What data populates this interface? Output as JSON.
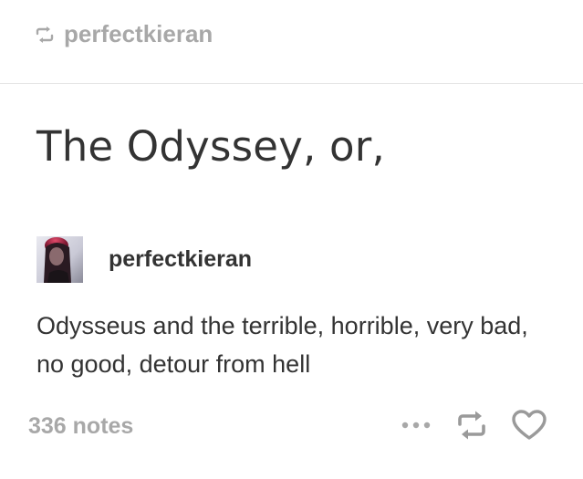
{
  "header": {
    "reblog_icon": "reblog-icon",
    "reblogged_from": "perfectkieran"
  },
  "post": {
    "title": "The Odyssey, or,",
    "author": {
      "avatar_icon": "user-avatar",
      "name": "perfectkieran"
    },
    "body": "Odysseus and the terrible, horrible, very bad, no good, detour from hell"
  },
  "footer": {
    "notes": "336 notes",
    "actions": [
      {
        "icon": "more-dots-icon"
      },
      {
        "icon": "reblog-icon"
      },
      {
        "icon": "heart-icon"
      }
    ]
  },
  "colors": {
    "muted_gray": "#a8a8a8",
    "text_dark": "#333333",
    "divider": "#e6e6e6"
  }
}
